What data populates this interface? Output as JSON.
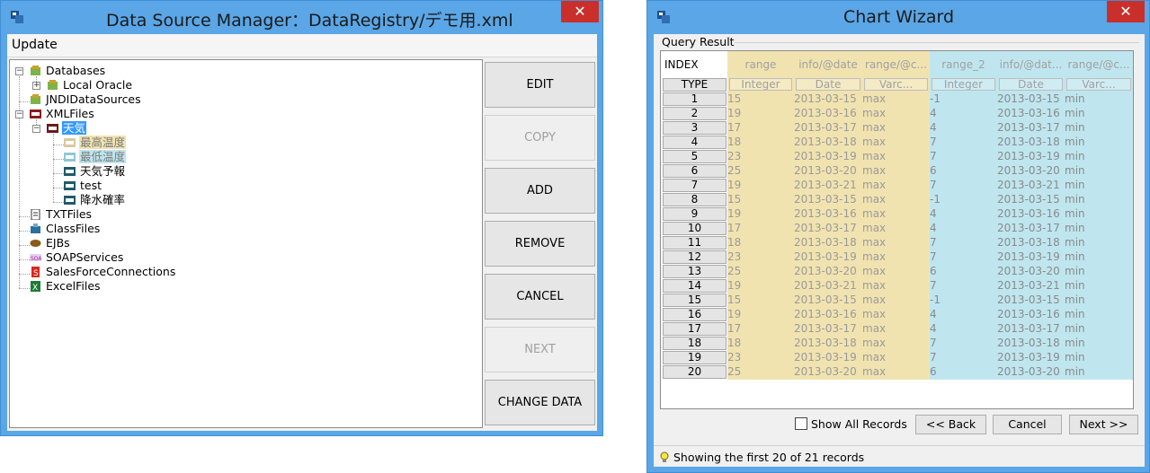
{
  "dsm": {
    "title": "Data Source Manager：DataRegistry/デモ用.xml",
    "close_label": "✕",
    "menu": [
      "Update"
    ],
    "tree": [
      {
        "label": "Databases",
        "icon": "database-icon"
      },
      {
        "label": "Local Oracle",
        "icon": "database-icon"
      },
      {
        "label": "JNDIDataSources",
        "icon": "database-icon"
      },
      {
        "label": "XMLFiles",
        "icon": "xml-folder-icon"
      },
      {
        "label": "天気",
        "icon": "xml-file-icon"
      },
      {
        "label": "最高温度",
        "icon": "xql-query-icon"
      },
      {
        "label": "最低温度",
        "icon": "xql-query-icon"
      },
      {
        "label": "天気予報",
        "icon": "xql-query-icon"
      },
      {
        "label": "test",
        "icon": "xql-query-icon"
      },
      {
        "label": "降水確率",
        "icon": "xql-query-icon"
      },
      {
        "label": "TXTFiles",
        "icon": "text-file-icon"
      },
      {
        "label": "ClassFiles",
        "icon": "class-file-icon"
      },
      {
        "label": "EJBs",
        "icon": "ejb-bean-icon"
      },
      {
        "label": "SOAPServices",
        "icon": "soap-icon"
      },
      {
        "label": "SalesForceConnections",
        "icon": "salesforce-icon"
      },
      {
        "label": "ExcelFiles",
        "icon": "excel-icon"
      }
    ],
    "buttons": {
      "edit": "EDIT",
      "copy": "COPY",
      "add": "ADD",
      "remove": "REMOVE",
      "cancel": "CANCEL",
      "next": "NEXT",
      "change_data": "CHANGE DATA"
    }
  },
  "cw": {
    "title": "Chart Wizard",
    "close_label": "✕",
    "group_label": "Query Result",
    "index_header": "INDEX",
    "type_header": "TYPE",
    "columns": [
      {
        "name": "range",
        "type": "Integer"
      },
      {
        "name": "info/@date",
        "type": "Date"
      },
      {
        "name": "range/@c...",
        "type": "Varc..."
      },
      {
        "name": "range_2",
        "type": "Integer"
      },
      {
        "name": "info/@dat...",
        "type": "Date"
      },
      {
        "name": "range/@c...",
        "type": "Varc..."
      }
    ],
    "rows": [
      [
        "1",
        "15",
        "2013-03-15",
        "max",
        "-1",
        "2013-03-15",
        "min"
      ],
      [
        "2",
        "19",
        "2013-03-16",
        "max",
        "4",
        "2013-03-16",
        "min"
      ],
      [
        "3",
        "17",
        "2013-03-17",
        "max",
        "4",
        "2013-03-17",
        "min"
      ],
      [
        "4",
        "18",
        "2013-03-18",
        "max",
        "7",
        "2013-03-18",
        "min"
      ],
      [
        "5",
        "23",
        "2013-03-19",
        "max",
        "7",
        "2013-03-19",
        "min"
      ],
      [
        "6",
        "25",
        "2013-03-20",
        "max",
        "6",
        "2013-03-20",
        "min"
      ],
      [
        "7",
        "19",
        "2013-03-21",
        "max",
        "7",
        "2013-03-21",
        "min"
      ],
      [
        "8",
        "15",
        "2013-03-15",
        "max",
        "-1",
        "2013-03-15",
        "min"
      ],
      [
        "9",
        "19",
        "2013-03-16",
        "max",
        "4",
        "2013-03-16",
        "min"
      ],
      [
        "10",
        "17",
        "2013-03-17",
        "max",
        "4",
        "2013-03-17",
        "min"
      ],
      [
        "11",
        "18",
        "2013-03-18",
        "max",
        "7",
        "2013-03-18",
        "min"
      ],
      [
        "12",
        "23",
        "2013-03-19",
        "max",
        "7",
        "2013-03-19",
        "min"
      ],
      [
        "13",
        "25",
        "2013-03-20",
        "max",
        "6",
        "2013-03-20",
        "min"
      ],
      [
        "14",
        "19",
        "2013-03-21",
        "max",
        "7",
        "2013-03-21",
        "min"
      ],
      [
        "15",
        "15",
        "2013-03-15",
        "max",
        "-1",
        "2013-03-15",
        "min"
      ],
      [
        "16",
        "19",
        "2013-03-16",
        "max",
        "4",
        "2013-03-16",
        "min"
      ],
      [
        "17",
        "17",
        "2013-03-17",
        "max",
        "4",
        "2013-03-17",
        "min"
      ],
      [
        "18",
        "18",
        "2013-03-18",
        "max",
        "7",
        "2013-03-18",
        "min"
      ],
      [
        "19",
        "23",
        "2013-03-19",
        "max",
        "7",
        "2013-03-19",
        "min"
      ],
      [
        "20",
        "25",
        "2013-03-20",
        "max",
        "6",
        "2013-03-20",
        "min"
      ]
    ],
    "show_all_label": "Show All Records",
    "show_all_checked": false,
    "back_label": "<< Back",
    "cancel_label": "Cancel",
    "next_label": "Next >>",
    "status": "Showing the first 20 of 21 records"
  },
  "colors": {
    "title_bar": "#5aa6e6",
    "close_button": "#c9302c",
    "selection": "#3399ff",
    "yellow_series": "#f1e3b0",
    "cyan_series": "#bfe6ef"
  }
}
